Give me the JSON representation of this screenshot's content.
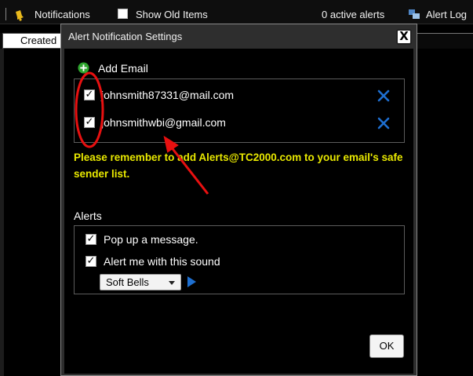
{
  "toolbar": {
    "notifications_label": "Notifications",
    "show_old_items_label": "Show Old Items",
    "show_old_items_checked": false,
    "active_alerts": "0 active alerts",
    "alert_log_label": "Alert Log"
  },
  "table": {
    "created_header": "Created"
  },
  "dialog": {
    "title": "Alert Notification Settings",
    "close_glyph": "X",
    "add_email_label": "Add Email",
    "emails": [
      {
        "address": "johnsmith87331@mail.com",
        "checked": true,
        "icon": "delete-x-icon"
      },
      {
        "address": "johnsmithwbi@gmail.com",
        "checked": true,
        "icon": "delete-x-icon"
      }
    ],
    "notice": "Please remember to add Alerts@TC2000.com to your email's safe sender list.",
    "alerts_label": "Alerts",
    "alert_options": [
      {
        "label": "Pop up a message.",
        "checked": true
      },
      {
        "label": "Alert me with this sound",
        "checked": true
      }
    ],
    "sound_selected": "Soft Bells",
    "ok_label": "OK"
  },
  "colors": {
    "notice": "#e8e800",
    "delete_icon": "#1e6fd0",
    "annotation": "#e81010",
    "add_icon": "#2ea52e"
  },
  "icons": [
    "bell-icon",
    "alert-log-icon",
    "add-circle-icon",
    "delete-x-icon",
    "play-icon",
    "close-icon"
  ]
}
